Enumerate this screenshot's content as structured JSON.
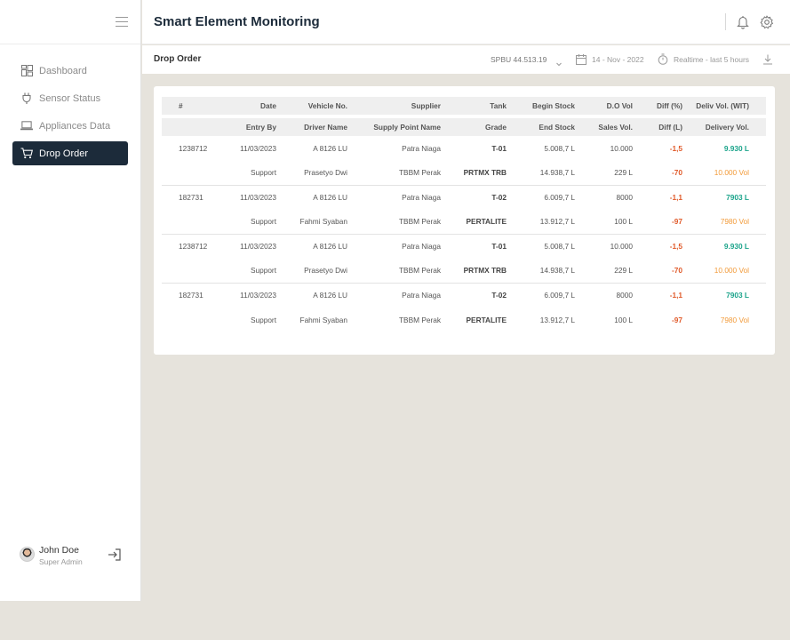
{
  "app": {
    "title": "Smart Element Monitoring"
  },
  "sidebar": {
    "items": [
      {
        "label": "Dashboard",
        "icon": "dashboard-icon",
        "active": false
      },
      {
        "label": "Sensor Status",
        "icon": "plug-icon",
        "active": false
      },
      {
        "label": "Appliances Data",
        "icon": "laptop-icon",
        "active": false
      },
      {
        "label": "Drop Order",
        "icon": "cart-icon",
        "active": true
      }
    ],
    "user": {
      "name": "John Doe",
      "role": "Super Admin"
    }
  },
  "subheader": {
    "page_title": "Drop Order",
    "station": "SPBU 44.513.19",
    "date": "14 - Nov - 2022",
    "realtime": "Realtime - last 5 hours"
  },
  "table": {
    "header1": [
      "#",
      "Date",
      "Vehicle No.",
      "Supplier",
      "Tank",
      "Begin Stock",
      "D.O Vol",
      "Diff (%)",
      "Deliv Vol. (WIT)"
    ],
    "header2": [
      "",
      "Entry By",
      "Driver Name",
      "Supply Point Name",
      "Grade",
      "End Stock",
      "Sales Vol.",
      "Diff (L)",
      "Delivery Vol."
    ],
    "rows": [
      {
        "r1": [
          "1238712",
          "11/03/2023",
          "A 8126 LU",
          "Patra Niaga",
          "T-01",
          "5.008,7 L",
          "10.000",
          "-1,5",
          "9.930 L"
        ],
        "r2": [
          "",
          "Support",
          "Prasetyo Dwi",
          "TBBM Perak",
          "PRTMX TRB",
          "14.938,7 L",
          "229 L",
          "-70",
          "10.000 Vol"
        ]
      },
      {
        "r1": [
          "182731",
          "11/03/2023",
          "A 8126 LU",
          "Patra Niaga",
          "T-02",
          "6.009,7 L",
          "8000",
          "-1,1",
          "7903 L"
        ],
        "r2": [
          "",
          "Support",
          "Fahmi Syaban",
          "TBBM Perak",
          "PERTALITE",
          "13.912,7 L",
          "100 L",
          "-97",
          "7980 Vol"
        ]
      },
      {
        "r1": [
          "1238712",
          "11/03/2023",
          "A 8126 LU",
          "Patra Niaga",
          "T-01",
          "5.008,7 L",
          "10.000",
          "-1,5",
          "9.930 L"
        ],
        "r2": [
          "",
          "Support",
          "Prasetyo Dwi",
          "TBBM Perak",
          "PRTMX TRB",
          "14.938,7 L",
          "229 L",
          "-70",
          "10.000 Vol"
        ]
      },
      {
        "r1": [
          "182731",
          "11/03/2023",
          "A 8126 LU",
          "Patra Niaga",
          "T-02",
          "6.009,7 L",
          "8000",
          "-1,1",
          "7903 L"
        ],
        "r2": [
          "",
          "Support",
          "Fahmi Syaban",
          "TBBM Perak",
          "PERTALITE",
          "13.912,7 L",
          "100 L",
          "-97",
          "7980 Vol"
        ]
      }
    ]
  },
  "colors": {
    "sidebar_active": "#1c2b3a",
    "negative": "#e05a2a",
    "positive": "#1aa38a",
    "volume": "#f29b3a",
    "background": "#e6e3dc"
  }
}
